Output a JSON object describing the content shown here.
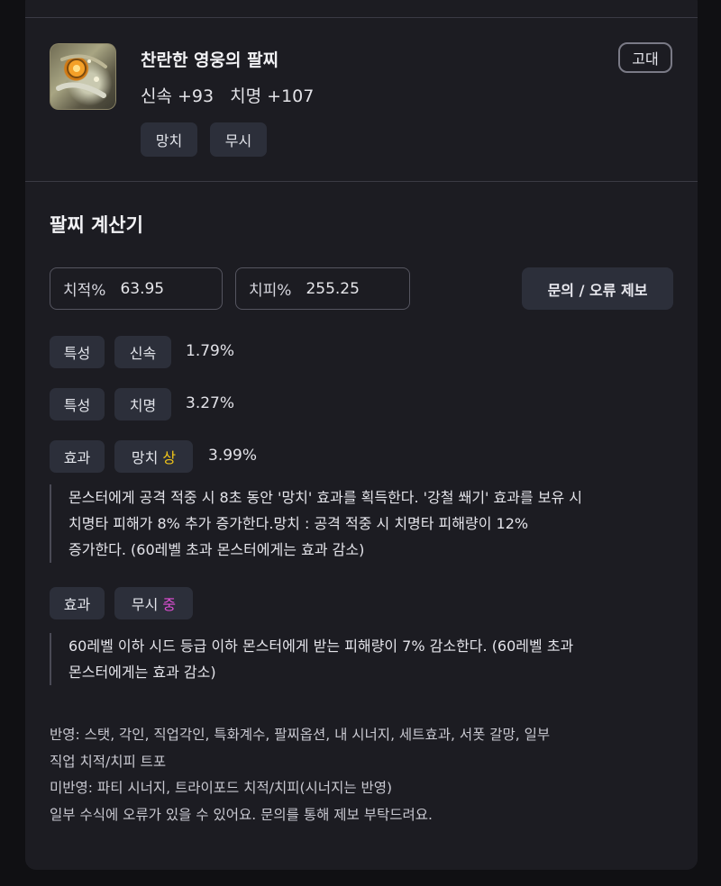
{
  "item": {
    "name": "찬란한 영웅의 팔찌",
    "stat1": "신속 +93",
    "stat2": "치명 +107",
    "grade": "고대",
    "tags": [
      "망치",
      "무시"
    ],
    "icon": "bracelet-icon"
  },
  "calculator": {
    "title": "팔찌 계산기",
    "crit_rate_label": "치적%",
    "crit_rate_value": "63.95",
    "crit_dmg_label": "치피%",
    "crit_dmg_value": "255.25",
    "report_button": "문의 / 오류 제보"
  },
  "rows": [
    {
      "type": "특성",
      "name": "신속",
      "value": "1.79%"
    },
    {
      "type": "특성",
      "name": "치명",
      "value": "3.27%"
    },
    {
      "type": "효과",
      "name": "망치",
      "level": "상",
      "value": "3.99%",
      "desc": [
        "몬스터에게 공격 적중 시 8초 동안 '망치' 효과를 획득한다. '강철 쐐기' 효과를 보유 시",
        "치명타 피해가 8% 추가 증가한다.망치 : 공격 적중 시 치명타 피해량이 12%",
        "증가한다. (60레벨 초과 몬스터에게는 효과 감소)"
      ]
    },
    {
      "type": "효과",
      "name": "무시",
      "level": "중",
      "value": "",
      "desc": [
        "60레벨 이하 시드 등급 이하 몬스터에게 받는 피해량이 7% 감소한다. (60레벨 초과",
        "몬스터에게는 효과 감소)"
      ]
    }
  ],
  "notes": [
    "반영: 스탯, 각인, 직업각인, 특화계수, 팔찌옵션, 내 시너지, 세트효과, 서폿 갈망, 일부",
    "직업 치적/치피 트포",
    "미반영: 파티 시너지, 트라이포드 치적/치피(시너지는 반영)",
    "일부 수식에 오류가 있을 수 있어요. 문의를 통해 제보 부탁드려요."
  ],
  "colors": {
    "background": "#101013",
    "card": "#1c1c22",
    "chip": "#2c2f3a",
    "level_high": "#f0c419",
    "level_mid": "#e04fd6"
  }
}
